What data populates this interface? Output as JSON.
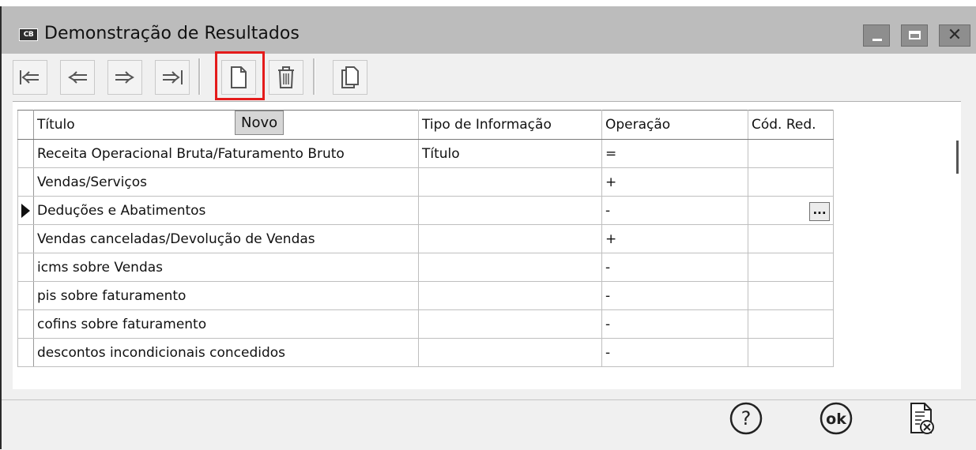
{
  "window": {
    "icon_label": "CB",
    "title": "Demonstração de Resultados"
  },
  "toolbar": {
    "buttons": [
      {
        "name": "first-record",
        "icon": "first-arrow-icon"
      },
      {
        "name": "previous-record",
        "icon": "left-arrow-icon"
      },
      {
        "name": "next-record",
        "icon": "right-arrow-icon"
      },
      {
        "name": "last-record",
        "icon": "last-arrow-icon"
      },
      {
        "name": "new-record",
        "icon": "new-document-icon"
      },
      {
        "name": "delete-record",
        "icon": "trash-icon"
      },
      {
        "name": "copy-record",
        "icon": "copy-icon"
      }
    ],
    "tooltip": "Novo"
  },
  "grid": {
    "headers": [
      "Título",
      "Tipo de Informação",
      "Operação",
      "Cód. Red."
    ],
    "rows": [
      {
        "titulo": "Receita Operacional Bruta/Faturamento Bruto",
        "tipo": "Título",
        "operacao": "=",
        "cod": ""
      },
      {
        "titulo": "Vendas/Serviços",
        "tipo": "",
        "operacao": "+",
        "cod": ""
      },
      {
        "titulo": "Deduções e Abatimentos",
        "tipo": "",
        "operacao": "-",
        "cod": ""
      },
      {
        "titulo": "Vendas canceladas/Devolução de Vendas",
        "tipo": "",
        "operacao": "+",
        "cod": ""
      },
      {
        "titulo": "icms sobre Vendas",
        "tipo": "",
        "operacao": "-",
        "cod": ""
      },
      {
        "titulo": "pis sobre faturamento",
        "tipo": "",
        "operacao": "-",
        "cod": ""
      },
      {
        "titulo": "cofins sobre faturamento",
        "tipo": "",
        "operacao": "-",
        "cod": ""
      },
      {
        "titulo": "descontos incondicionais concedidos",
        "tipo": "",
        "operacao": "-",
        "cod": ""
      }
    ],
    "current_row_index": 2,
    "lookup_button": "..."
  },
  "footer": {
    "help_icon": "help-icon",
    "ok_icon": "ok-icon",
    "cancel_icon": "cancel-document-icon",
    "ok_label": "ok",
    "help_label": "?"
  }
}
